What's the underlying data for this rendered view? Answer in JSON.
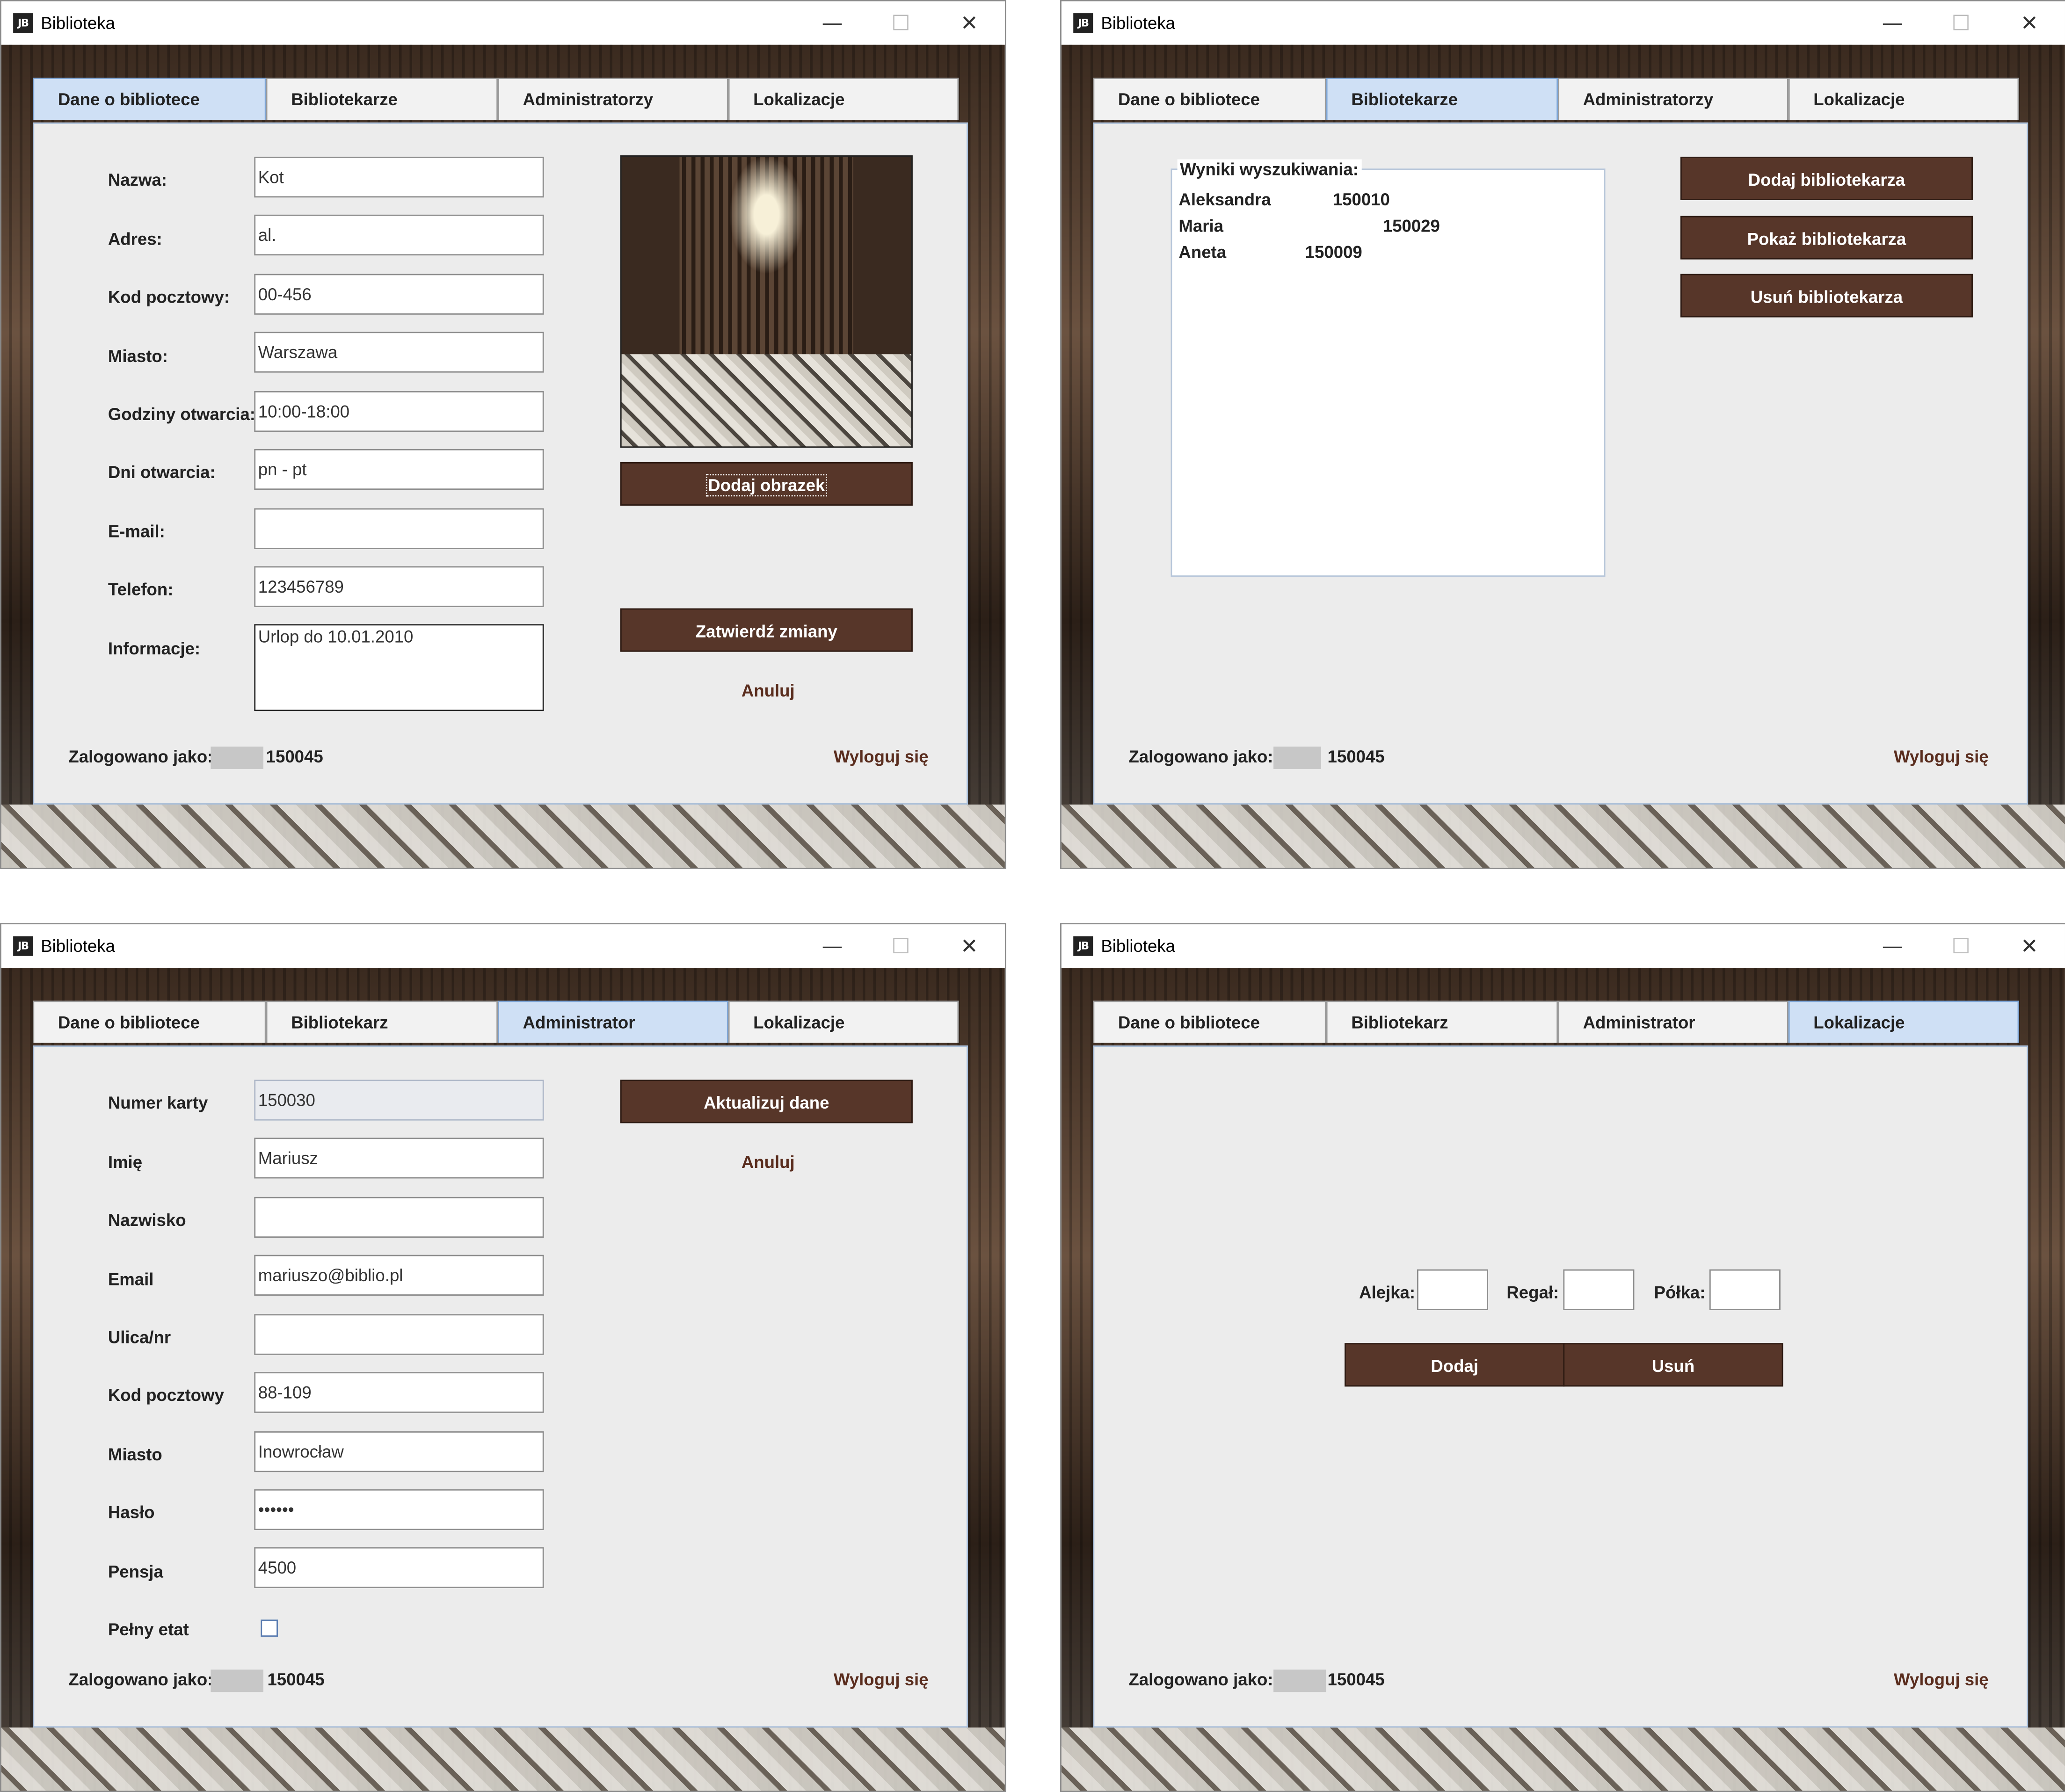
{
  "app": {
    "title": "Biblioteka",
    "icon_text": "JB"
  },
  "window_controls": {
    "minimize": "—",
    "maximize": "☐",
    "close": "✕"
  },
  "footer": {
    "logged_label": "Zalogowano jako:",
    "user_id": "150045",
    "logout": "Wyloguj się"
  },
  "w1": {
    "tabs": [
      "Dane o bibliotece",
      "Bibliotekarze",
      "Administratorzy",
      "Lokalizacje"
    ],
    "active_tab": 0,
    "fields": [
      {
        "label": "Nazwa:",
        "value": "Kot"
      },
      {
        "label": "Adres:",
        "value": "al."
      },
      {
        "label": "Kod pocztowy:",
        "value": "00-456"
      },
      {
        "label": "Miasto:",
        "value": "Warszawa"
      },
      {
        "label": "Godziny otwarcia:",
        "value": "10:00-18:00"
      },
      {
        "label": "Dni otwarcia:",
        "value": "pn - pt"
      },
      {
        "label": "E-mail:",
        "value": ""
      },
      {
        "label": "Telefon:",
        "value": "123456789"
      },
      {
        "label": "Informacje:",
        "value": "Urlop do 10.01.2010"
      }
    ],
    "add_image": "Dodaj obrazek",
    "confirm": "Zatwierdź zmiany",
    "cancel": "Anuluj"
  },
  "w2": {
    "tabs": [
      "Dane o bibliotece",
      "Bibliotekarze",
      "Administratorzy",
      "Lokalizacje"
    ],
    "active_tab": 1,
    "results_title": "Wyniki wyszukiwania:",
    "results": [
      {
        "name": "Aleksandra",
        "id": "150010"
      },
      {
        "name": "Maria",
        "id": "150029"
      },
      {
        "name": "Aneta",
        "id": "150009"
      }
    ],
    "add": "Dodaj bibliotekarza",
    "show": "Pokaż bibliotekarza",
    "remove": "Usuń bibliotekarza"
  },
  "w3": {
    "tabs": [
      "Dane o bibliotece",
      "Bibliotekarz",
      "Administrator",
      "Lokalizacje"
    ],
    "active_tab": 2,
    "fields": [
      {
        "label": "Numer karty",
        "value": "150030"
      },
      {
        "label": "Imię",
        "value": "Mariusz"
      },
      {
        "label": "Nazwisko",
        "value": ""
      },
      {
        "label": "Email",
        "value": "mariuszo@biblio.pl"
      },
      {
        "label": "Ulica/nr",
        "value": ""
      },
      {
        "label": "Kod pocztowy",
        "value": "88-109"
      },
      {
        "label": "Miasto",
        "value": "Inowrocław"
      },
      {
        "label": "Hasło",
        "value": "••••••"
      },
      {
        "label": "Pensja",
        "value": "4500"
      }
    ],
    "fulltime_label": "Pełny etat",
    "update": "Aktualizuj dane",
    "cancel": "Anuluj"
  },
  "w4": {
    "tabs": [
      "Dane o bibliotece",
      "Bibliotekarz",
      "Administrator",
      "Lokalizacje"
    ],
    "active_tab": 3,
    "alley_label": "Alejka:",
    "rack_label": "Regał:",
    "shelf_label": "Półka:",
    "add": "Dodaj",
    "remove": "Usuń"
  }
}
